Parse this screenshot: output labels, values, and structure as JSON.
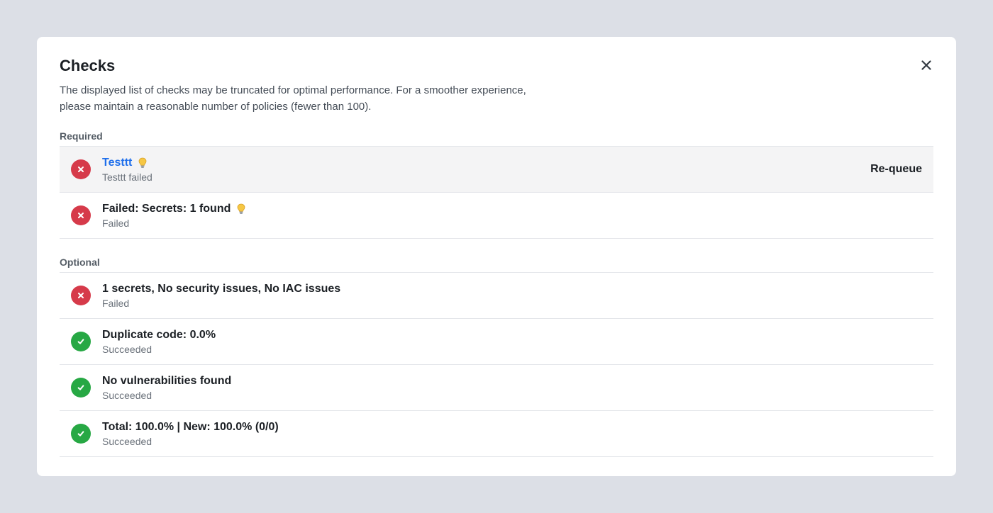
{
  "modal": {
    "title": "Checks",
    "description": "The displayed list of checks may be truncated for optimal performance. For a smoother experience, please maintain a reasonable number of policies (fewer than 100)."
  },
  "required": {
    "label": "Required",
    "items": [
      {
        "title": "Testtt",
        "subtitle": "Testtt failed",
        "status": "failed",
        "action": "Re-queue"
      },
      {
        "title": "Failed: Secrets: 1 found",
        "subtitle": "Failed",
        "status": "failed"
      }
    ]
  },
  "optional": {
    "label": "Optional",
    "items": [
      {
        "title": "1 secrets, No security issues, No IAC issues",
        "subtitle": "Failed",
        "status": "failed"
      },
      {
        "title": "Duplicate code: 0.0%",
        "subtitle": "Succeeded",
        "status": "succeeded"
      },
      {
        "title": "No vulnerabilities found",
        "subtitle": "Succeeded",
        "status": "succeeded"
      },
      {
        "title": "Total: 100.0% | New: 100.0% (0/0)",
        "subtitle": "Succeeded",
        "status": "succeeded"
      }
    ]
  },
  "icons": {
    "close": "close-icon",
    "failed": "x-icon",
    "succeeded": "check-icon",
    "hint": "lightbulb-icon"
  },
  "colors": {
    "failed": "#d63a4a",
    "succeeded": "#27a844",
    "link": "#1f6feb",
    "highlight": "#f4f4f5"
  }
}
